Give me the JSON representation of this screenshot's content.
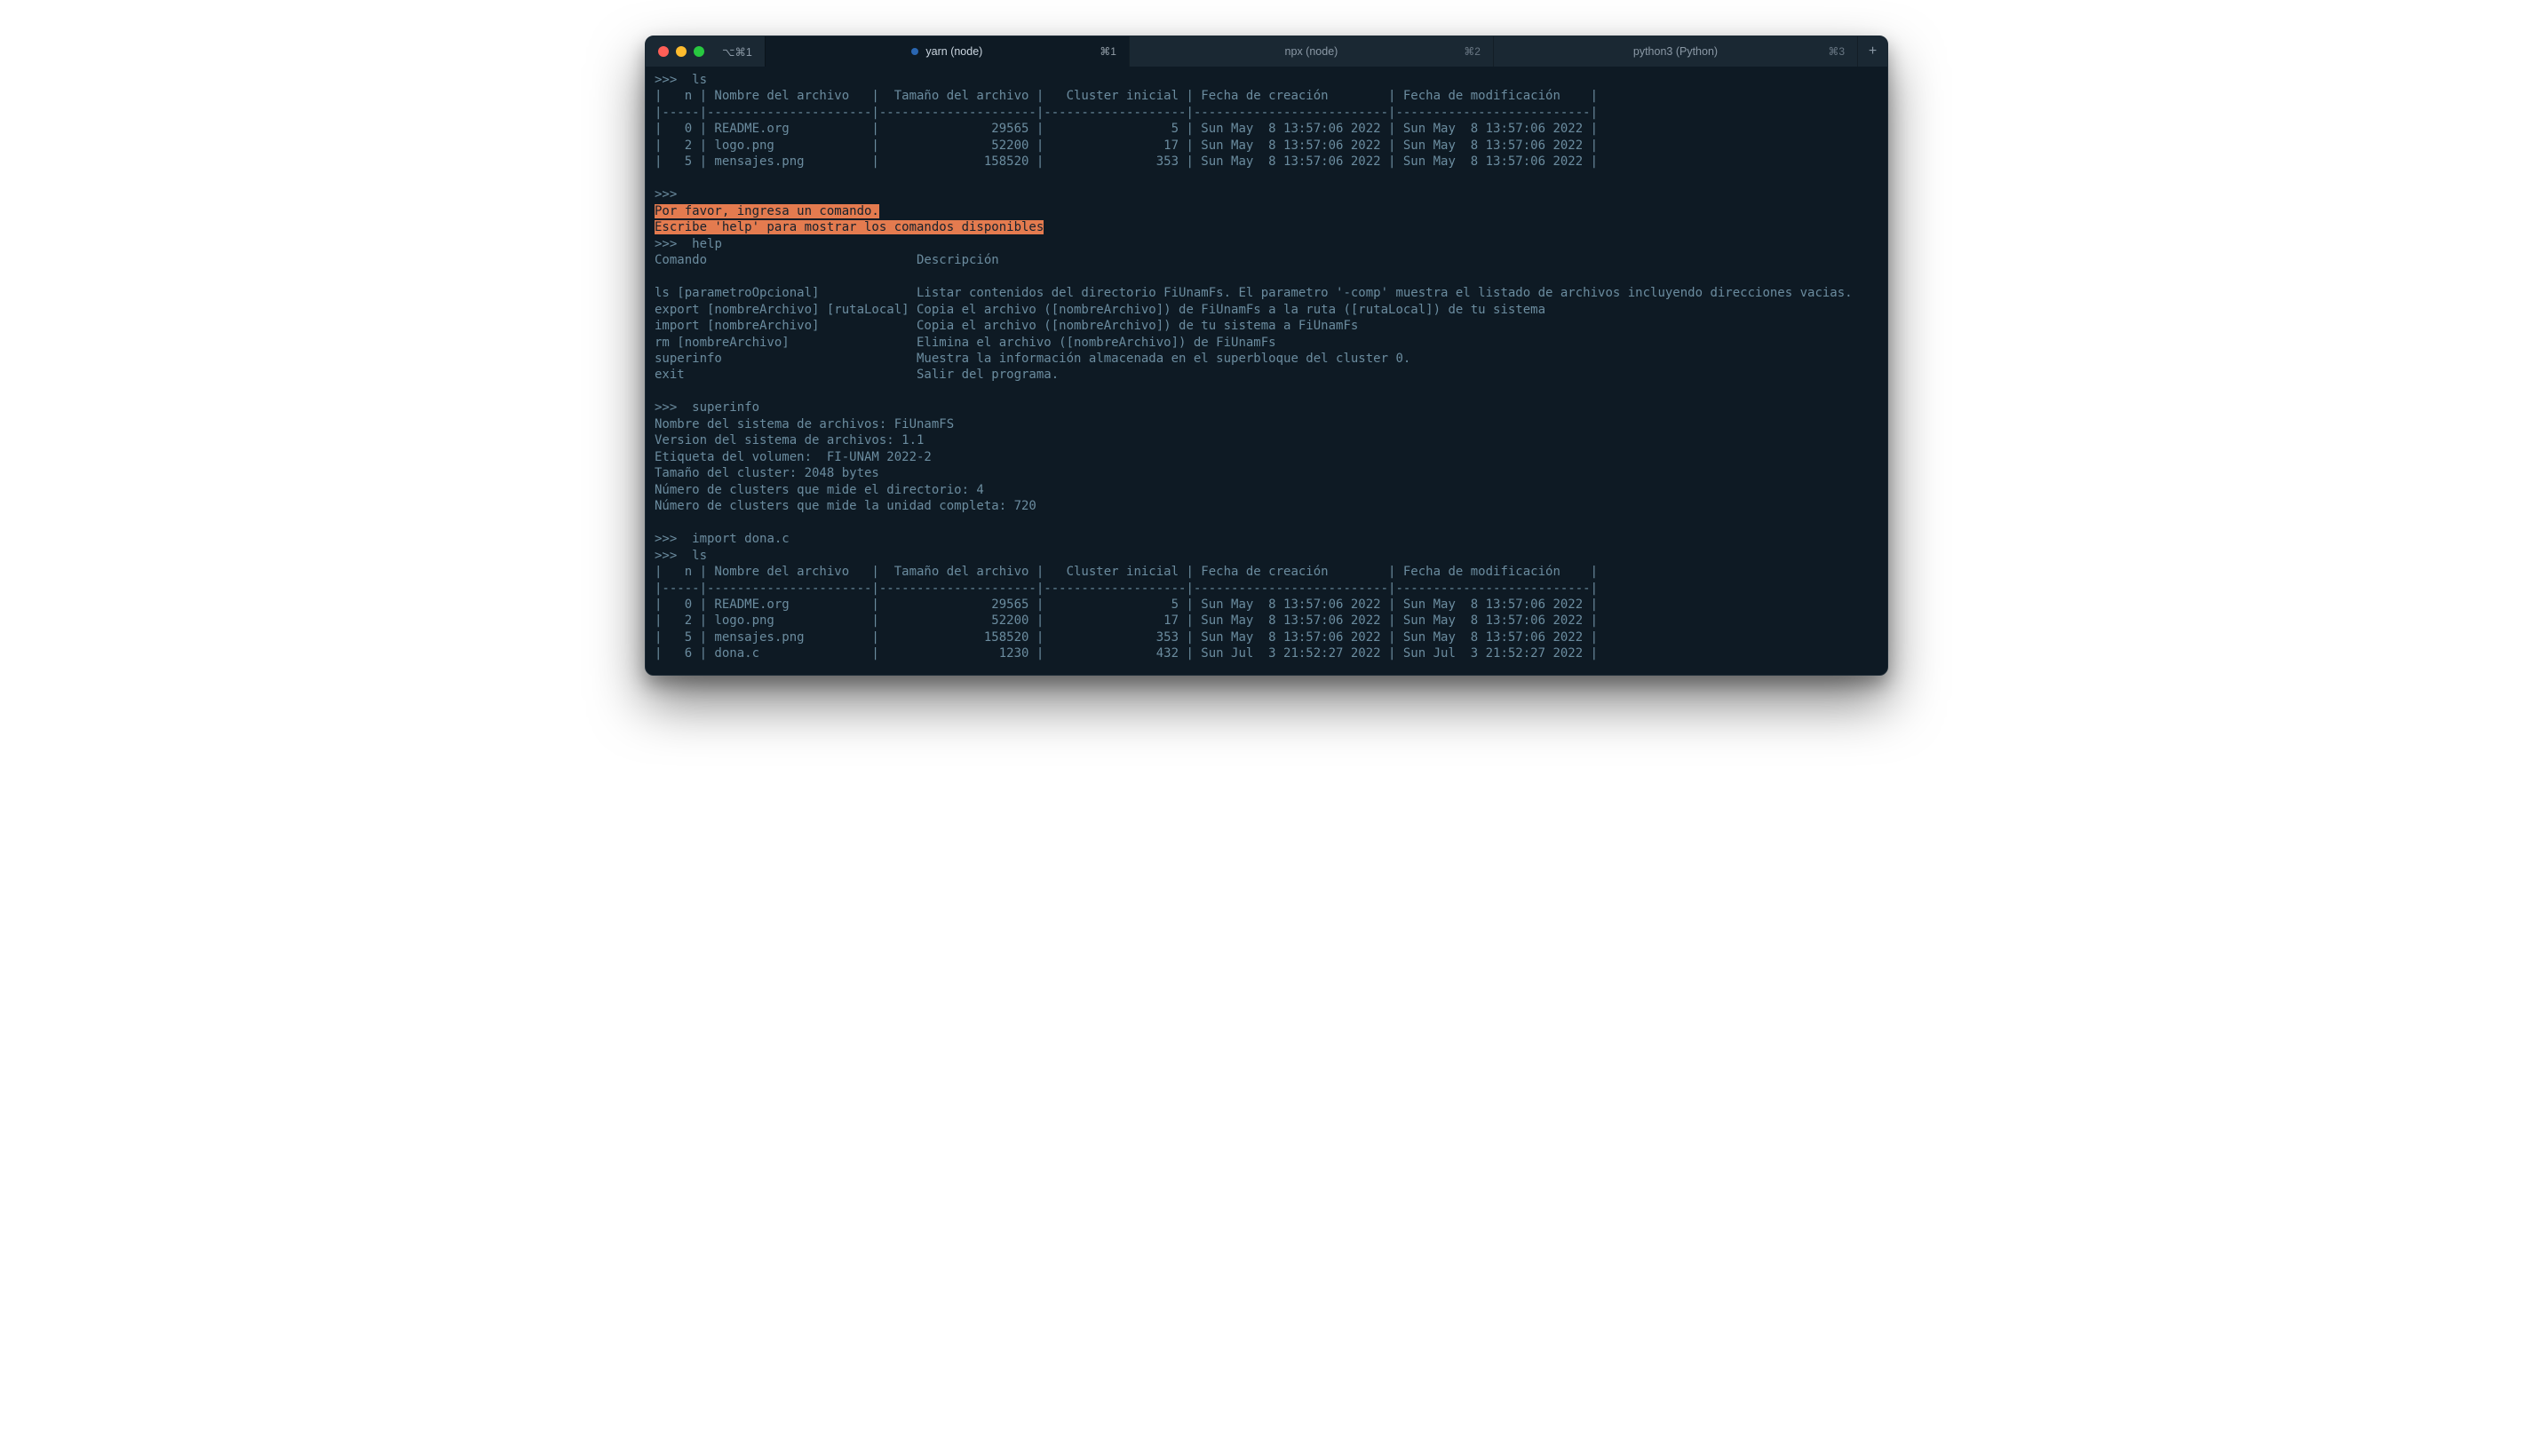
{
  "titlebar": {
    "group_label": "⌥⌘1",
    "tabs": [
      {
        "label": "yarn (node)",
        "shortcut": "⌘1",
        "active": true,
        "dirty": true
      },
      {
        "label": "npx (node)",
        "shortcut": "⌘2",
        "active": false,
        "dirty": false
      },
      {
        "label": "python3 (Python)",
        "shortcut": "⌘3",
        "active": false,
        "dirty": false
      }
    ],
    "new_tab_label": "+"
  },
  "session": {
    "prompt": ">>>",
    "ls1": {
      "cmd": "ls",
      "header": "|   n | Nombre del archivo   |  Tamaño del archivo |   Cluster inicial | Fecha de creación        | Fecha de modificación    |",
      "rule": "|-----|----------------------|---------------------|-------------------|--------------------------|--------------------------|",
      "rows": [
        "|   0 | README.org           |               29565 |                 5 | Sun May  8 13:57:06 2022 | Sun May  8 13:57:06 2022 |",
        "|   2 | logo.png             |               52200 |                17 | Sun May  8 13:57:06 2022 | Sun May  8 13:57:06 2022 |",
        "|   5 | mensajes.png         |              158520 |               353 | Sun May  8 13:57:06 2022 | Sun May  8 13:57:06 2022 |"
      ]
    },
    "empty_cmd": {
      "msg1": "Por favor, ingresa un comando.",
      "msg2": "Escribe 'help' para mostrar los comandos disponibles"
    },
    "help": {
      "cmd": "help",
      "header": "Comando                            Descripción",
      "blank": "",
      "rows": [
        "ls [parametroOpcional]             Listar contenidos del directorio FiUnamFs. El parametro '-comp' muestra el listado de archivos incluyendo direcciones vacias.",
        "export [nombreArchivo] [rutaLocal] Copia el archivo ([nombreArchivo]) de FiUnamFs a la ruta ([rutaLocal]) de tu sistema",
        "import [nombreArchivo]             Copia el archivo ([nombreArchivo]) de tu sistema a FiUnamFs",
        "rm [nombreArchivo]                 Elimina el archivo ([nombreArchivo]) de FiUnamFs",
        "superinfo                          Muestra la información almacenada en el superbloque del cluster 0.",
        "exit                               Salir del programa."
      ]
    },
    "superinfo": {
      "cmd": "superinfo",
      "lines": [
        "Nombre del sistema de archivos: FiUnamFS",
        "Version del sistema de archivos: 1.1",
        "Etiqueta del volumen:  FI-UNAM 2022-2",
        "Tamaño del cluster: 2048 bytes",
        "Número de clusters que mide el directorio: 4",
        "Número de clusters que mide la unidad completa: 720"
      ]
    },
    "import_cmd": "import dona.c",
    "ls2": {
      "cmd": "ls",
      "header": "|   n | Nombre del archivo   |  Tamaño del archivo |   Cluster inicial | Fecha de creación        | Fecha de modificación    |",
      "rule": "|-----|----------------------|---------------------|-------------------|--------------------------|--------------------------|",
      "rows": [
        "|   0 | README.org           |               29565 |                 5 | Sun May  8 13:57:06 2022 | Sun May  8 13:57:06 2022 |",
        "|   2 | logo.png             |               52200 |                17 | Sun May  8 13:57:06 2022 | Sun May  8 13:57:06 2022 |",
        "|   5 | mensajes.png         |              158520 |               353 | Sun May  8 13:57:06 2022 | Sun May  8 13:57:06 2022 |",
        "|   6 | dona.c               |                1230 |               432 | Sun Jul  3 21:52:27 2022 | Sun Jul  3 21:52:27 2022 |"
      ]
    }
  }
}
